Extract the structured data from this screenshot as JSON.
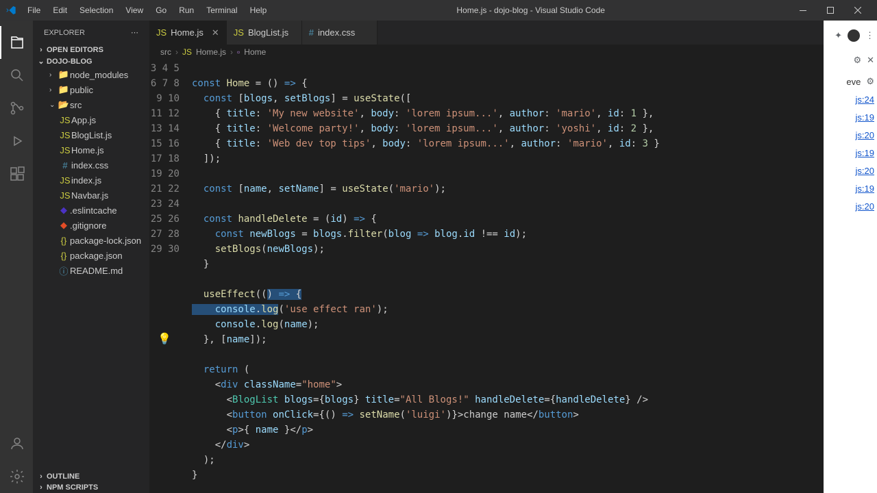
{
  "window": {
    "title": "Home.js - dojo-blog - Visual Studio Code",
    "menu": [
      "File",
      "Edit",
      "Selection",
      "View",
      "Go",
      "Run",
      "Terminal",
      "Help"
    ]
  },
  "sidebar": {
    "title": "EXPLORER",
    "sections": {
      "open_editors": "OPEN EDITORS",
      "project": "DOJO-BLOG",
      "outline": "OUTLINE",
      "npm": "NPM SCRIPTS"
    },
    "tree": {
      "node_modules": "node_modules",
      "public": "public",
      "src": "src",
      "app_js": "App.js",
      "bloglist_js": "BlogList.js",
      "home_js": "Home.js",
      "index_css": "index.css",
      "index_js": "index.js",
      "navbar_js": "Navbar.js",
      "eslintcache": ".eslintcache",
      "gitignore": ".gitignore",
      "package_lock": "package-lock.json",
      "package_json": "package.json",
      "readme": "README.md"
    }
  },
  "tabs": {
    "home": "Home.js",
    "bloglist": "BlogList.js",
    "indexcss": "index.css"
  },
  "breadcrumb": {
    "src": "src",
    "file": "Home.js",
    "symbol": "Home"
  },
  "code": {
    "lines_start": 3,
    "lines_end": 30,
    "l4_const": "const",
    "l4_home": "Home",
    "l4_rest": " = () ",
    "l5_const": "const",
    "l5_blogs": "blogs",
    "l5_setblogs": "setBlogs",
    "l5_usestate": "useState",
    "l6_title": "title",
    "l6_str1": "'My new website'",
    "l6_body": "body",
    "l6_str2": "'lorem ipsum...'",
    "l6_author": "author",
    "l6_str3": "'mario'",
    "l6_id": "id",
    "l6_num": "1",
    "l7_str1": "'Welcome party!'",
    "l7_str2": "'lorem ipsum...'",
    "l7_str3": "'yoshi'",
    "l7_num": "2",
    "l8_str1": "'Web dev top tips'",
    "l8_str2": "'lorem ipsum...'",
    "l8_str3": "'mario'",
    "l8_num": "3",
    "l11_name": "name",
    "l11_setname": "setName",
    "l11_str": "'mario'",
    "l13_handledelete": "handleDelete",
    "l13_id": "id",
    "l14_newblogs": "newBlogs",
    "l14_blogs": "blogs",
    "l14_filter": "filter",
    "l14_blog": "blog",
    "l15_setblogs": "setBlogs",
    "l15_newblogs": "newBlogs",
    "l18_useeffect": "useEffect",
    "l19_console": "console",
    "l19_log": "log",
    "l19_str": "'use effect ran'",
    "l20_console": "console",
    "l20_log": "log",
    "l20_name": "name",
    "l21_name": "name",
    "l23_return": "return",
    "l24_div": "div",
    "l24_classname": "className",
    "l24_str": "\"home\"",
    "l25_bloglist": "BlogList",
    "l25_blogs": "blogs",
    "l25_title": "title",
    "l25_str": "\"All Blogs!\"",
    "l25_hd": "handleDelete",
    "l26_button": "button",
    "l26_onclick": "onClick",
    "l26_setname": "setName",
    "l26_str": "'luigi'",
    "l26_text": "change name",
    "l27_p": "p",
    "l27_name": "name"
  },
  "right_panel": {
    "eve": "eve",
    "links": [
      "js:24",
      "js:19",
      "js:20",
      "js:19",
      "js:20",
      "js:19",
      "js:20"
    ]
  }
}
